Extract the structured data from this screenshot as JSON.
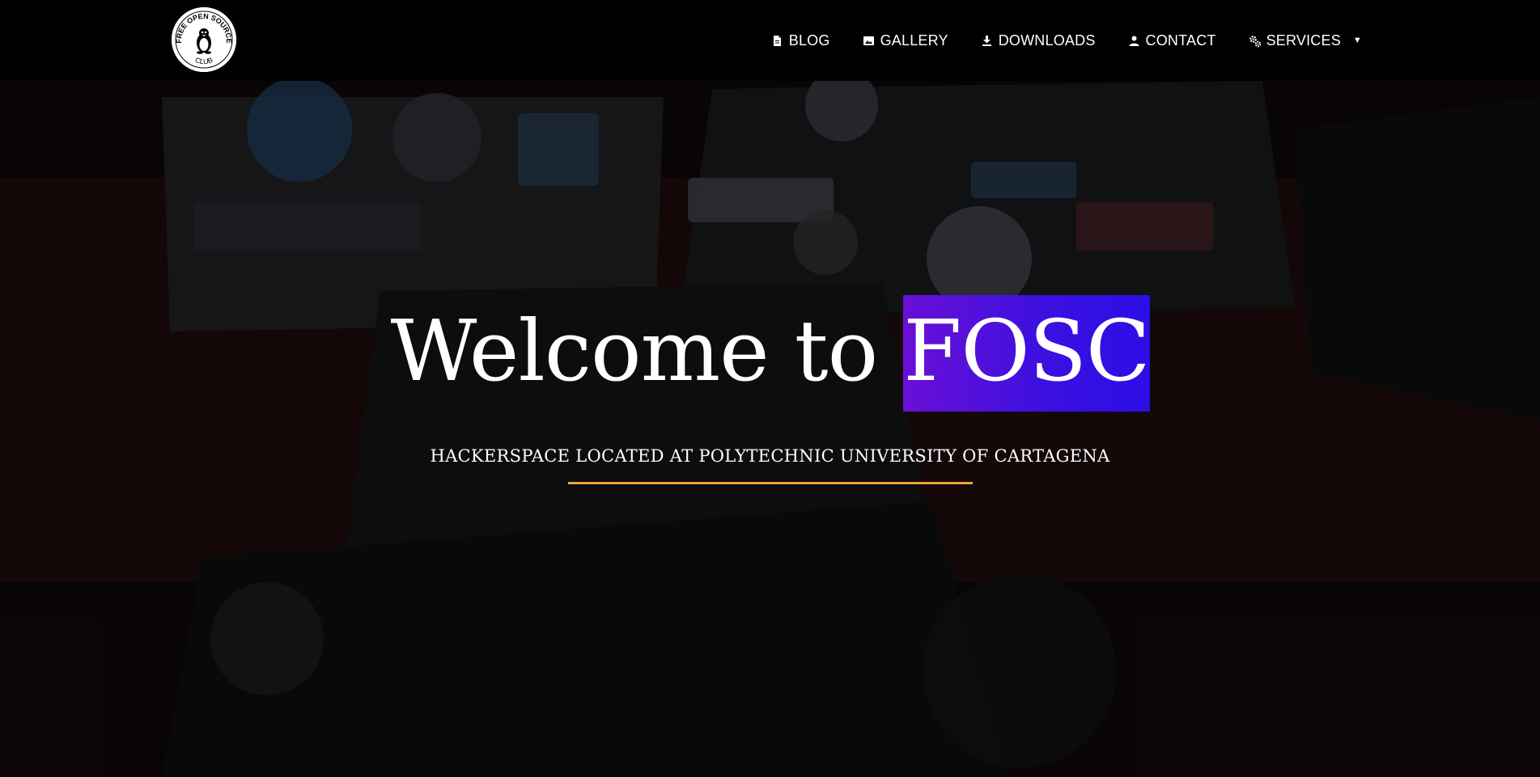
{
  "logo": {
    "text_top": "FREE OPEN SOURCE",
    "text_bottom": "CLUB"
  },
  "nav": {
    "items": [
      {
        "label": "BLOG",
        "icon": "document-icon"
      },
      {
        "label": "GALLERY",
        "icon": "image-icon"
      },
      {
        "label": "DOWNLOADS",
        "icon": "download-icon"
      },
      {
        "label": "CONTACT",
        "icon": "person-icon"
      },
      {
        "label": "SERVICES",
        "icon": "gears-icon",
        "dropdown": true
      }
    ],
    "dropdown_caret": "▼"
  },
  "hero": {
    "title_prefix": "Welcome to ",
    "title_highlight": "FOSC",
    "subtitle": "HACKERSPACE LOCATED AT POLYTECHNIC UNIVERSITY OF CARTAGENA"
  },
  "colors": {
    "navbar_bg": "#000000",
    "highlight_start": "#6a0fd6",
    "highlight_end": "#2c0ee6",
    "divider": "#f0a33a",
    "text": "#ffffff"
  }
}
